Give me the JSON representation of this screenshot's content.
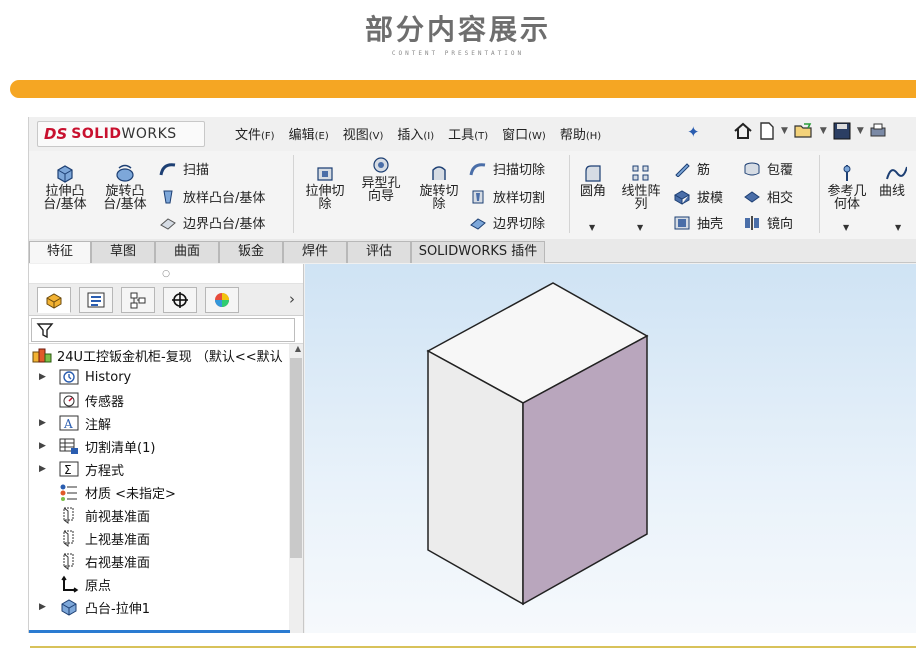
{
  "header": {
    "title": "部分内容展示",
    "subtitle": "CONTENT PRESENTATION"
  },
  "app": {
    "logo_ds": "DS",
    "logo_solid": "SOLID",
    "logo_works": "WORKS",
    "menu": [
      {
        "label": "文件",
        "key": "(F)"
      },
      {
        "label": "编辑",
        "key": "(E)"
      },
      {
        "label": "视图",
        "key": "(V)"
      },
      {
        "label": "插入",
        "key": "(I)"
      },
      {
        "label": "工具",
        "key": "(T)"
      },
      {
        "label": "窗口",
        "key": "(W)"
      },
      {
        "label": "帮助",
        "key": "(H)"
      }
    ]
  },
  "ribbon": {
    "extrude_boss": [
      "拉伸凸",
      "台/基体"
    ],
    "revolve_boss": [
      "旋转凸",
      "台/基体"
    ],
    "sweep": "扫描",
    "loft": "放样凸台/基体",
    "boundary": "边界凸台/基体",
    "extrude_cut": [
      "拉伸切",
      "除"
    ],
    "hole_wizard": [
      "异型孔",
      "向导"
    ],
    "revolve_cut": [
      "旋转切",
      "除"
    ],
    "swept_cut": "扫描切除",
    "lofted_cut": "放样切割",
    "boundary_cut": "边界切除",
    "fillet": "圆角",
    "linear_pattern": [
      "线性阵",
      "列"
    ],
    "rib": "筋",
    "draft": "拔模",
    "shell": "抽壳",
    "wrap": "包覆",
    "intersect": "相交",
    "mirror": "镜向",
    "ref_geometry": [
      "参考几",
      "何体"
    ],
    "curves": "曲线"
  },
  "tabs": [
    "特征",
    "草图",
    "曲面",
    "钣金",
    "焊件",
    "评估",
    "SOLIDWORKS 插件"
  ],
  "tree": {
    "root": "24U工控钣金机柜-复现 （默认<<默认",
    "items": [
      {
        "label": "History",
        "expandable": true
      },
      {
        "label": "传感器",
        "expandable": false
      },
      {
        "label": "注解",
        "expandable": true
      },
      {
        "label": "切割清单(1)",
        "expandable": true
      },
      {
        "label": "方程式",
        "expandable": true
      },
      {
        "label": "材质 <未指定>",
        "expandable": false
      },
      {
        "label": "前视基准面",
        "expandable": false
      },
      {
        "label": "上视基准面",
        "expandable": false
      },
      {
        "label": "右视基准面",
        "expandable": false
      },
      {
        "label": "原点",
        "expandable": false
      },
      {
        "label": "凸台-拉伸1",
        "expandable": true
      }
    ]
  },
  "colors": {
    "accent_bar": "#f5a623",
    "box_top": "#f7f7f7",
    "box_front": "#ececec",
    "box_side": "#b9a6bd"
  }
}
